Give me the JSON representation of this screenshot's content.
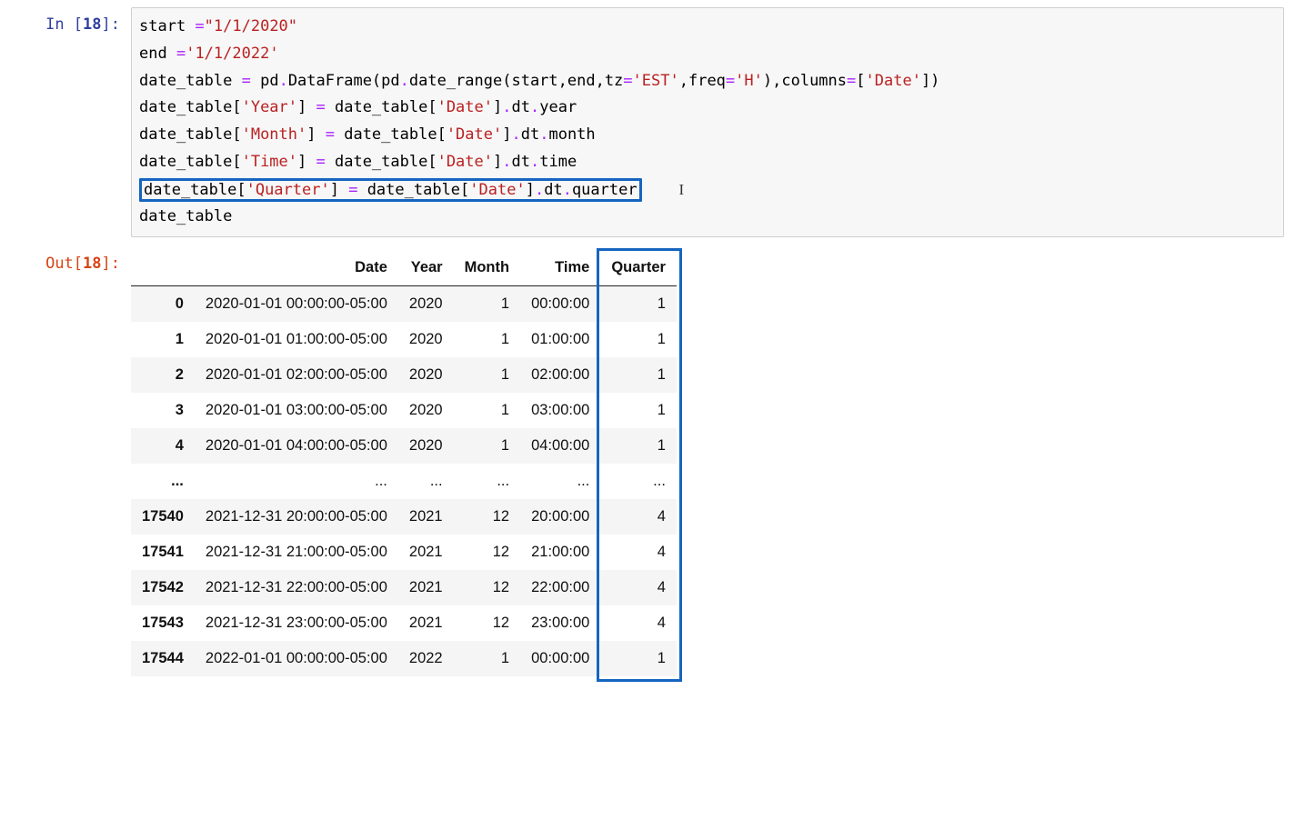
{
  "execution_count": "18",
  "code": {
    "tokens": [
      [
        {
          "t": "start ",
          "c": "nam"
        },
        {
          "t": "=",
          "c": "op"
        },
        {
          "t": "\"1/1/2020\"",
          "c": "str"
        }
      ],
      [
        {
          "t": "end ",
          "c": "nam"
        },
        {
          "t": "=",
          "c": "op"
        },
        {
          "t": "'1/1/2022'",
          "c": "str"
        }
      ],
      [
        {
          "t": "date_table ",
          "c": "nam"
        },
        {
          "t": "=",
          "c": "op"
        },
        {
          "t": " pd",
          "c": "nam"
        },
        {
          "t": ".",
          "c": "op"
        },
        {
          "t": "DataFrame(pd",
          "c": "nam"
        },
        {
          "t": ".",
          "c": "op"
        },
        {
          "t": "date_range(start,end,tz",
          "c": "nam"
        },
        {
          "t": "=",
          "c": "op"
        },
        {
          "t": "'EST'",
          "c": "str"
        },
        {
          "t": ",freq",
          "c": "nam"
        },
        {
          "t": "=",
          "c": "op"
        },
        {
          "t": "'H'",
          "c": "str"
        },
        {
          "t": "),columns",
          "c": "nam"
        },
        {
          "t": "=",
          "c": "op"
        },
        {
          "t": "[",
          "c": "pun"
        },
        {
          "t": "'Date'",
          "c": "str"
        },
        {
          "t": "])",
          "c": "pun"
        }
      ],
      [
        {
          "t": "date_table[",
          "c": "nam"
        },
        {
          "t": "'Year'",
          "c": "str"
        },
        {
          "t": "] ",
          "c": "nam"
        },
        {
          "t": "=",
          "c": "op"
        },
        {
          "t": " date_table[",
          "c": "nam"
        },
        {
          "t": "'Date'",
          "c": "str"
        },
        {
          "t": "]",
          "c": "nam"
        },
        {
          "t": ".",
          "c": "op"
        },
        {
          "t": "dt",
          "c": "nam"
        },
        {
          "t": ".",
          "c": "op"
        },
        {
          "t": "year",
          "c": "nam"
        }
      ],
      [
        {
          "t": "date_table[",
          "c": "nam"
        },
        {
          "t": "'Month'",
          "c": "str"
        },
        {
          "t": "] ",
          "c": "nam"
        },
        {
          "t": "=",
          "c": "op"
        },
        {
          "t": " date_table[",
          "c": "nam"
        },
        {
          "t": "'Date'",
          "c": "str"
        },
        {
          "t": "]",
          "c": "nam"
        },
        {
          "t": ".",
          "c": "op"
        },
        {
          "t": "dt",
          "c": "nam"
        },
        {
          "t": ".",
          "c": "op"
        },
        {
          "t": "month",
          "c": "nam"
        }
      ],
      [
        {
          "t": "date_table[",
          "c": "nam"
        },
        {
          "t": "'Time'",
          "c": "str"
        },
        {
          "t": "] ",
          "c": "nam"
        },
        {
          "t": "=",
          "c": "op"
        },
        {
          "t": " date_table[",
          "c": "nam"
        },
        {
          "t": "'Date'",
          "c": "str"
        },
        {
          "t": "]",
          "c": "nam"
        },
        {
          "t": ".",
          "c": "op"
        },
        {
          "t": "dt",
          "c": "nam"
        },
        {
          "t": ".",
          "c": "op"
        },
        {
          "t": "time",
          "c": "nam"
        }
      ],
      "__HL__",
      [
        {
          "t": "date_table",
          "c": "nam"
        }
      ]
    ],
    "highlighted_line": [
      {
        "t": "date_table[",
        "c": "nam"
      },
      {
        "t": "'Quarter'",
        "c": "str"
      },
      {
        "t": "] ",
        "c": "nam"
      },
      {
        "t": "=",
        "c": "op"
      },
      {
        "t": " date_table[",
        "c": "nam"
      },
      {
        "t": "'Date'",
        "c": "str"
      },
      {
        "t": "]",
        "c": "nam"
      },
      {
        "t": ".",
        "c": "op"
      },
      {
        "t": "dt",
        "c": "nam"
      },
      {
        "t": ".",
        "c": "op"
      },
      {
        "t": "quarter",
        "c": "nam"
      }
    ]
  },
  "table": {
    "columns": [
      "",
      "Date",
      "Year",
      "Month",
      "Time",
      "Quarter"
    ],
    "rows": [
      {
        "idx": "0",
        "Date": "2020-01-01 00:00:00-05:00",
        "Year": "2020",
        "Month": "1",
        "Time": "00:00:00",
        "Quarter": "1"
      },
      {
        "idx": "1",
        "Date": "2020-01-01 01:00:00-05:00",
        "Year": "2020",
        "Month": "1",
        "Time": "01:00:00",
        "Quarter": "1"
      },
      {
        "idx": "2",
        "Date": "2020-01-01 02:00:00-05:00",
        "Year": "2020",
        "Month": "1",
        "Time": "02:00:00",
        "Quarter": "1"
      },
      {
        "idx": "3",
        "Date": "2020-01-01 03:00:00-05:00",
        "Year": "2020",
        "Month": "1",
        "Time": "03:00:00",
        "Quarter": "1"
      },
      {
        "idx": "4",
        "Date": "2020-01-01 04:00:00-05:00",
        "Year": "2020",
        "Month": "1",
        "Time": "04:00:00",
        "Quarter": "1"
      },
      {
        "idx": "...",
        "Date": "...",
        "Year": "...",
        "Month": "...",
        "Time": "...",
        "Quarter": "..."
      },
      {
        "idx": "17540",
        "Date": "2021-12-31 20:00:00-05:00",
        "Year": "2021",
        "Month": "12",
        "Time": "20:00:00",
        "Quarter": "4"
      },
      {
        "idx": "17541",
        "Date": "2021-12-31 21:00:00-05:00",
        "Year": "2021",
        "Month": "12",
        "Time": "21:00:00",
        "Quarter": "4"
      },
      {
        "idx": "17542",
        "Date": "2021-12-31 22:00:00-05:00",
        "Year": "2021",
        "Month": "12",
        "Time": "22:00:00",
        "Quarter": "4"
      },
      {
        "idx": "17543",
        "Date": "2021-12-31 23:00:00-05:00",
        "Year": "2021",
        "Month": "12",
        "Time": "23:00:00",
        "Quarter": "4"
      },
      {
        "idx": "17544",
        "Date": "2022-01-01 00:00:00-05:00",
        "Year": "2022",
        "Month": "1",
        "Time": "00:00:00",
        "Quarter": "1"
      }
    ],
    "highlight_column": "Quarter"
  },
  "labels": {
    "in_prefix": "In [",
    "out_prefix": "Out[",
    "suffix": "]:"
  }
}
